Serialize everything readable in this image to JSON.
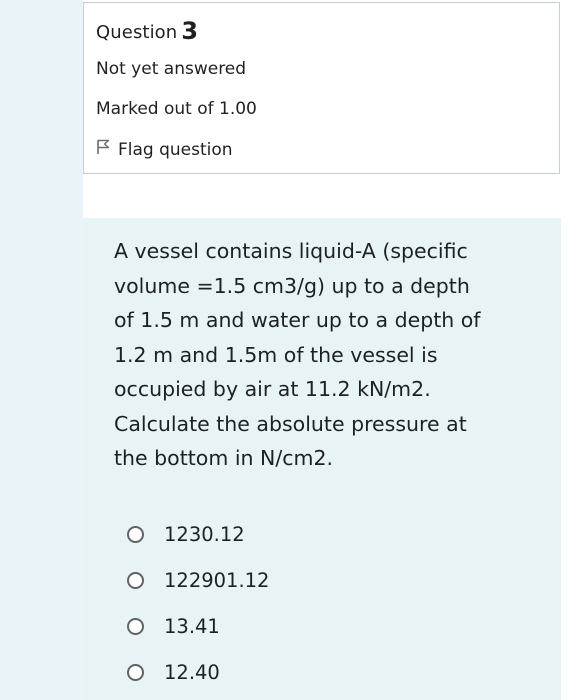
{
  "question": {
    "label": "Question",
    "number": "3",
    "state": "Not yet answered",
    "grade": "Marked out of 1.00",
    "flag_label": "Flag question",
    "text": "A vessel contains liquid-A (specific\nvolume =1.5 cm3/g) up to a depth\nof 1.5 m and water up to a depth of\n1.2 m and 1.5m of the vessel is\noccupied by air at 11.2 kN/m2.\nCalculate the absolute pressure at\nthe bottom in N/cm2."
  },
  "answers": [
    {
      "label": "1230.12"
    },
    {
      "label": "122901.12"
    },
    {
      "label": "13.41"
    },
    {
      "label": "12.40"
    }
  ],
  "icons": {
    "flag": "flag-outline-icon",
    "radio": "radio-unchecked-icon"
  },
  "colors": {
    "info_border": "#c9cfd6",
    "content_bg": "#e7f3f5",
    "sidebar_bg": "#e9f3f8",
    "text": "#1d2125"
  }
}
